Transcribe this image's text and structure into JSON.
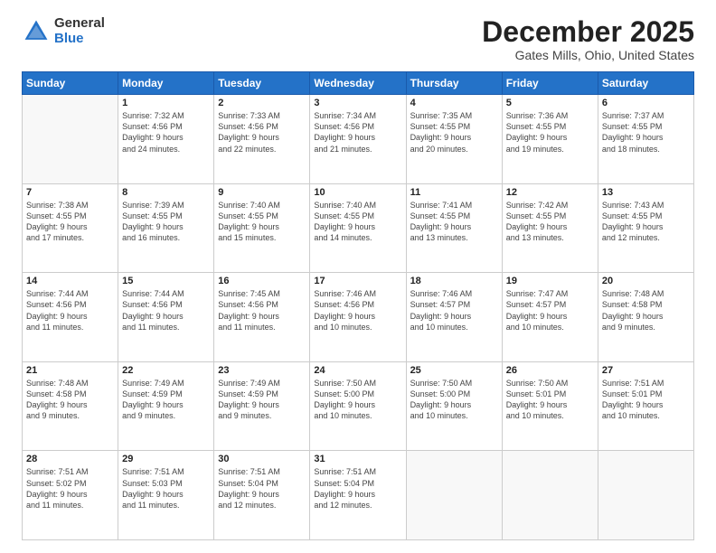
{
  "logo": {
    "general": "General",
    "blue": "Blue"
  },
  "header": {
    "title": "December 2025",
    "subtitle": "Gates Mills, Ohio, United States"
  },
  "weekdays": [
    "Sunday",
    "Monday",
    "Tuesday",
    "Wednesday",
    "Thursday",
    "Friday",
    "Saturday"
  ],
  "weeks": [
    [
      {
        "day": "",
        "info": ""
      },
      {
        "day": "1",
        "info": "Sunrise: 7:32 AM\nSunset: 4:56 PM\nDaylight: 9 hours\nand 24 minutes."
      },
      {
        "day": "2",
        "info": "Sunrise: 7:33 AM\nSunset: 4:56 PM\nDaylight: 9 hours\nand 22 minutes."
      },
      {
        "day": "3",
        "info": "Sunrise: 7:34 AM\nSunset: 4:56 PM\nDaylight: 9 hours\nand 21 minutes."
      },
      {
        "day": "4",
        "info": "Sunrise: 7:35 AM\nSunset: 4:55 PM\nDaylight: 9 hours\nand 20 minutes."
      },
      {
        "day": "5",
        "info": "Sunrise: 7:36 AM\nSunset: 4:55 PM\nDaylight: 9 hours\nand 19 minutes."
      },
      {
        "day": "6",
        "info": "Sunrise: 7:37 AM\nSunset: 4:55 PM\nDaylight: 9 hours\nand 18 minutes."
      }
    ],
    [
      {
        "day": "7",
        "info": "Sunrise: 7:38 AM\nSunset: 4:55 PM\nDaylight: 9 hours\nand 17 minutes."
      },
      {
        "day": "8",
        "info": "Sunrise: 7:39 AM\nSunset: 4:55 PM\nDaylight: 9 hours\nand 16 minutes."
      },
      {
        "day": "9",
        "info": "Sunrise: 7:40 AM\nSunset: 4:55 PM\nDaylight: 9 hours\nand 15 minutes."
      },
      {
        "day": "10",
        "info": "Sunrise: 7:40 AM\nSunset: 4:55 PM\nDaylight: 9 hours\nand 14 minutes."
      },
      {
        "day": "11",
        "info": "Sunrise: 7:41 AM\nSunset: 4:55 PM\nDaylight: 9 hours\nand 13 minutes."
      },
      {
        "day": "12",
        "info": "Sunrise: 7:42 AM\nSunset: 4:55 PM\nDaylight: 9 hours\nand 13 minutes."
      },
      {
        "day": "13",
        "info": "Sunrise: 7:43 AM\nSunset: 4:55 PM\nDaylight: 9 hours\nand 12 minutes."
      }
    ],
    [
      {
        "day": "14",
        "info": "Sunrise: 7:44 AM\nSunset: 4:56 PM\nDaylight: 9 hours\nand 11 minutes."
      },
      {
        "day": "15",
        "info": "Sunrise: 7:44 AM\nSunset: 4:56 PM\nDaylight: 9 hours\nand 11 minutes."
      },
      {
        "day": "16",
        "info": "Sunrise: 7:45 AM\nSunset: 4:56 PM\nDaylight: 9 hours\nand 11 minutes."
      },
      {
        "day": "17",
        "info": "Sunrise: 7:46 AM\nSunset: 4:56 PM\nDaylight: 9 hours\nand 10 minutes."
      },
      {
        "day": "18",
        "info": "Sunrise: 7:46 AM\nSunset: 4:57 PM\nDaylight: 9 hours\nand 10 minutes."
      },
      {
        "day": "19",
        "info": "Sunrise: 7:47 AM\nSunset: 4:57 PM\nDaylight: 9 hours\nand 10 minutes."
      },
      {
        "day": "20",
        "info": "Sunrise: 7:48 AM\nSunset: 4:58 PM\nDaylight: 9 hours\nand 9 minutes."
      }
    ],
    [
      {
        "day": "21",
        "info": "Sunrise: 7:48 AM\nSunset: 4:58 PM\nDaylight: 9 hours\nand 9 minutes."
      },
      {
        "day": "22",
        "info": "Sunrise: 7:49 AM\nSunset: 4:59 PM\nDaylight: 9 hours\nand 9 minutes."
      },
      {
        "day": "23",
        "info": "Sunrise: 7:49 AM\nSunset: 4:59 PM\nDaylight: 9 hours\nand 9 minutes."
      },
      {
        "day": "24",
        "info": "Sunrise: 7:50 AM\nSunset: 5:00 PM\nDaylight: 9 hours\nand 10 minutes."
      },
      {
        "day": "25",
        "info": "Sunrise: 7:50 AM\nSunset: 5:00 PM\nDaylight: 9 hours\nand 10 minutes."
      },
      {
        "day": "26",
        "info": "Sunrise: 7:50 AM\nSunset: 5:01 PM\nDaylight: 9 hours\nand 10 minutes."
      },
      {
        "day": "27",
        "info": "Sunrise: 7:51 AM\nSunset: 5:01 PM\nDaylight: 9 hours\nand 10 minutes."
      }
    ],
    [
      {
        "day": "28",
        "info": "Sunrise: 7:51 AM\nSunset: 5:02 PM\nDaylight: 9 hours\nand 11 minutes."
      },
      {
        "day": "29",
        "info": "Sunrise: 7:51 AM\nSunset: 5:03 PM\nDaylight: 9 hours\nand 11 minutes."
      },
      {
        "day": "30",
        "info": "Sunrise: 7:51 AM\nSunset: 5:04 PM\nDaylight: 9 hours\nand 12 minutes."
      },
      {
        "day": "31",
        "info": "Sunrise: 7:51 AM\nSunset: 5:04 PM\nDaylight: 9 hours\nand 12 minutes."
      },
      {
        "day": "",
        "info": ""
      },
      {
        "day": "",
        "info": ""
      },
      {
        "day": "",
        "info": ""
      }
    ]
  ]
}
